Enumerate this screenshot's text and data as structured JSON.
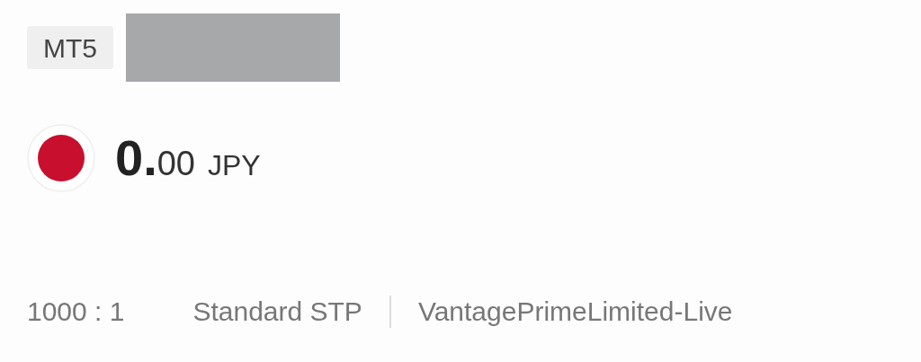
{
  "platform_badge": "MT5",
  "balance": {
    "whole": "0.",
    "fraction": "00",
    "currency": "JPY"
  },
  "details": {
    "leverage": "1000 : 1",
    "account_type": "Standard STP",
    "server": "VantagePrimeLimited-Live"
  }
}
